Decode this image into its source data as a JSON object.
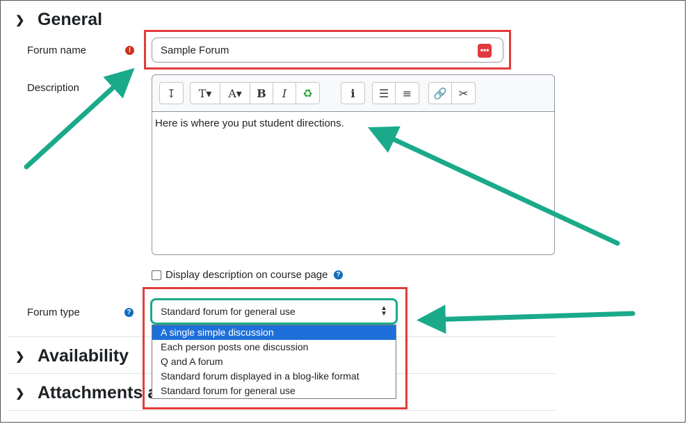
{
  "sections": {
    "general": "General",
    "availability": "Availability",
    "attachments": "Attachments and word count"
  },
  "fields": {
    "forum_name_label": "Forum name",
    "forum_name_value": "Sample Forum",
    "description_label": "Description",
    "description_value": "Here is where you put student directions.",
    "display_desc_label": "Display description on course page",
    "forum_type_label": "Forum type",
    "forum_type_value": "Standard forum for general use"
  },
  "toolbar": {
    "buttons": [
      "collapse",
      "paragraph-styles",
      "font-color",
      "bold",
      "italic",
      "accessibility",
      "info",
      "unordered-list",
      "ordered-list",
      "link",
      "unlink"
    ]
  },
  "forum_type_options": [
    "A single simple discussion",
    "Each person posts one discussion",
    "Q and A forum",
    "Standard forum displayed in a blog-like format",
    "Standard forum for general use"
  ],
  "colors": {
    "annotation_red": "#e23b3b",
    "annotation_arrow": "#1aaa8a",
    "selected_option": "#1e6fd9",
    "required": "#ca3120",
    "help": "#0f6cbf"
  }
}
